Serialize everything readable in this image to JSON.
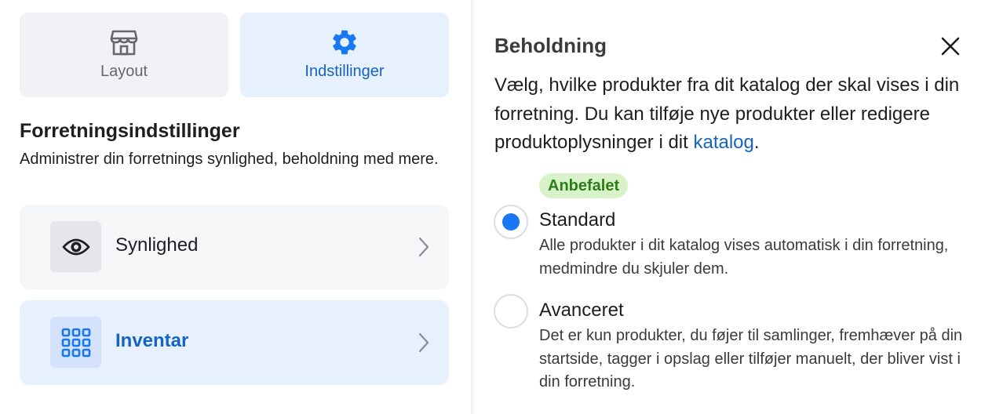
{
  "tabs": [
    {
      "label": "Layout",
      "icon": "storefront-icon",
      "selected": false
    },
    {
      "label": "Indstillinger",
      "icon": "gear-icon",
      "selected": true
    }
  ],
  "section": {
    "title": "Forretningsindstillinger",
    "description": "Administrer din forretnings synlighed, beholdning med mere."
  },
  "settings_items": [
    {
      "label": "Synlighed",
      "icon": "eye-icon",
      "selected": false
    },
    {
      "label": "Inventar",
      "icon": "grid-icon",
      "selected": true
    }
  ],
  "panel": {
    "title": "Beholdning",
    "close_icon": "close-icon",
    "description_before_link": "Vælg, hvilke produkter fra dit katalog der skal vises i din forretning. Du kan tilføje nye produkter eller redigere produktoplysninger i dit ",
    "link_text": "katalog",
    "description_after_link": ".",
    "recommended_badge": "Anbefalet",
    "options": [
      {
        "title": "Standard",
        "description": "Alle produkter i dit katalog vises automatisk i din forretning, medmindre du skjuler dem.",
        "selected": true
      },
      {
        "title": "Avanceret",
        "description": "Det er kun produkter, du føjer til samlinger, fremhæver på din startside, tagger i opslag eller tilføjer manuelt, der bliver vist i din forretning.",
        "selected": false
      }
    ]
  },
  "colors": {
    "accent": "#1877f2",
    "link": "#1565c0",
    "selected_bg": "#e7f0fd",
    "badge_bg": "#d8f3c9",
    "badge_text": "#2e7d18"
  }
}
